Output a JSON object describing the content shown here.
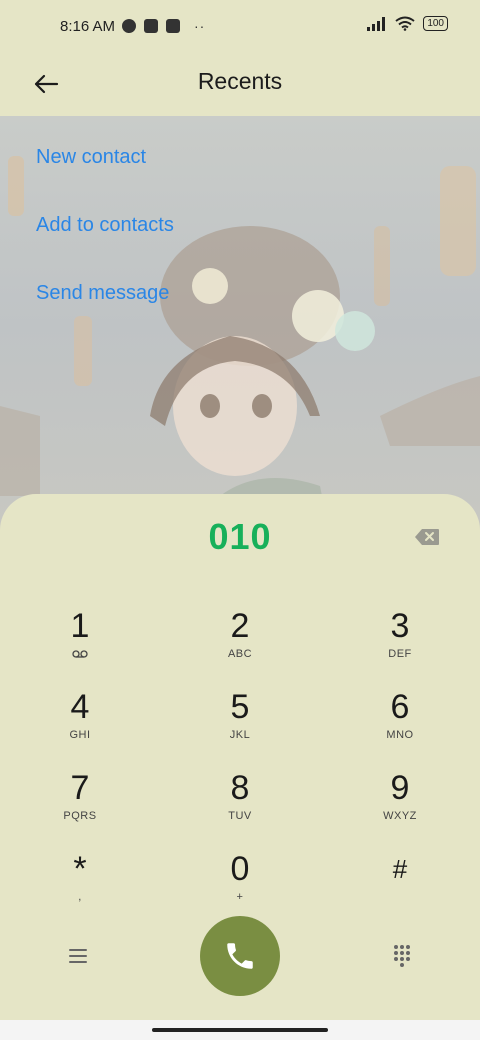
{
  "status_bar": {
    "time": "8:16 AM",
    "battery": "100"
  },
  "header": {
    "title": "Recents",
    "back_icon": "arrow-left-icon"
  },
  "actions": [
    "New contact",
    "Add to contacts",
    "Send message"
  ],
  "dialer": {
    "number": "010",
    "keys": [
      {
        "digit": "1",
        "sub": ""
      },
      {
        "digit": "2",
        "sub": "ABC"
      },
      {
        "digit": "3",
        "sub": "DEF"
      },
      {
        "digit": "4",
        "sub": "GHI"
      },
      {
        "digit": "5",
        "sub": "JKL"
      },
      {
        "digit": "6",
        "sub": "MNO"
      },
      {
        "digit": "7",
        "sub": "PQRS"
      },
      {
        "digit": "8",
        "sub": "TUV"
      },
      {
        "digit": "9",
        "sub": "WXYZ"
      },
      {
        "digit": "*",
        "sub": ","
      },
      {
        "digit": "0",
        "sub": "+"
      },
      {
        "digit": "#",
        "sub": ""
      }
    ]
  },
  "colors": {
    "background": "#e5e5c6",
    "number": "#17b05a",
    "link": "#2a86e6",
    "call_button": "#7a8e42"
  }
}
